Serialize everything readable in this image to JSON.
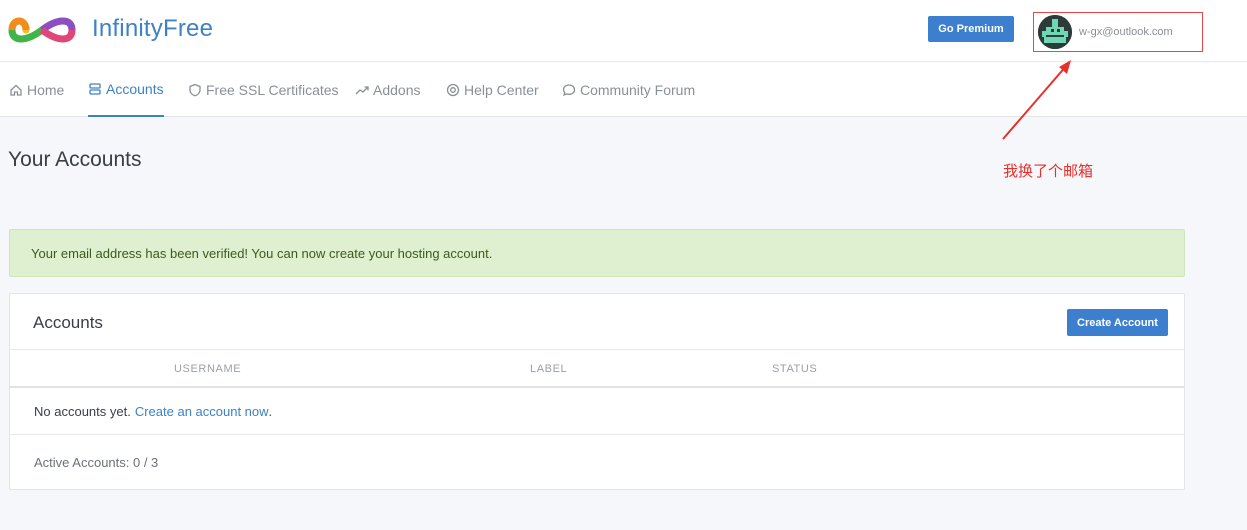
{
  "header": {
    "brand": "InfinityFree",
    "premium_label": "Go Premium",
    "user_email": "w-gx@outlook.com"
  },
  "nav": {
    "items": [
      {
        "label": "Home",
        "icon": "home-icon"
      },
      {
        "label": "Accounts",
        "icon": "server-icon",
        "active": true
      },
      {
        "label": "Free SSL Certificates",
        "icon": "shield-icon"
      },
      {
        "label": "Addons",
        "icon": "trend-icon"
      },
      {
        "label": "Help Center",
        "icon": "lifebuoy-icon"
      },
      {
        "label": "Community Forum",
        "icon": "chat-icon"
      }
    ]
  },
  "page": {
    "title": "Your Accounts",
    "annotation": "我换了个邮箱"
  },
  "alert": {
    "text": "Your email address has been verified! You can now create your hosting account."
  },
  "accounts_card": {
    "title": "Accounts",
    "create_label": "Create Account",
    "columns": [
      "USERNAME",
      "LABEL",
      "STATUS"
    ],
    "empty_text": "No accounts yet.",
    "empty_link": "Create an account now",
    "empty_suffix": ".",
    "active_accounts": "Active Accounts: 0 / 3"
  },
  "colors": {
    "accent": "#3d82c4",
    "button": "#3d7fcf",
    "alert_bg": "#def0cf",
    "annotation": "#e8302a"
  }
}
